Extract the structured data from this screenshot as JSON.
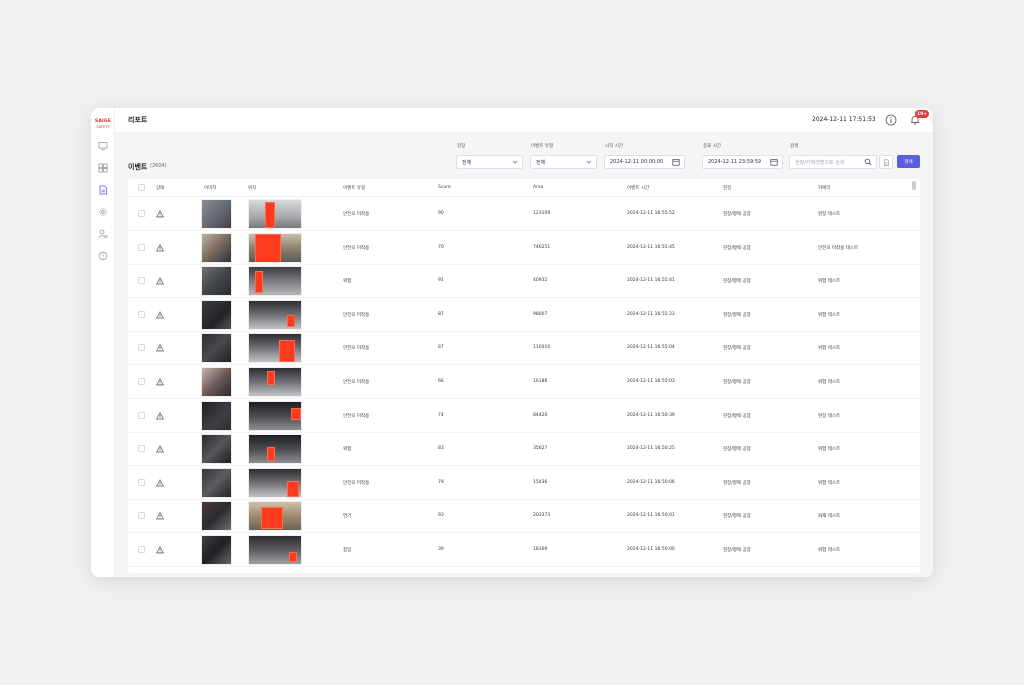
{
  "logo": {
    "line1": "SAIGE",
    "line2": "SAFETY"
  },
  "header": {
    "title": "리포트",
    "datetime": "2024-12-11 17:51:53",
    "notification_badge": "10+"
  },
  "sidebar": {
    "items": [
      {
        "icon": "monitor-icon"
      },
      {
        "icon": "dashboard-icon"
      },
      {
        "icon": "report-icon",
        "active": true
      },
      {
        "icon": "settings-icon"
      },
      {
        "icon": "user-settings-icon"
      },
      {
        "icon": "alert-icon"
      }
    ]
  },
  "section": {
    "title": "이벤트",
    "count": "(2604)"
  },
  "filters": {
    "location": {
      "label": "현장",
      "value": "전체"
    },
    "event_type": {
      "label": "이벤트 유형",
      "value": "전체"
    },
    "start_time": {
      "label": "시작 시간",
      "value": "2024-12-11 00:00:00"
    },
    "end_time": {
      "label": "종료 시간",
      "value": "2024-12-11 23:59:59"
    },
    "search": {
      "label": "검색",
      "placeholder": "현장/카메라명으로 검색"
    },
    "tilde": "~",
    "search_button": "검색"
  },
  "table": {
    "columns": [
      "상태",
      "이미지",
      "위치",
      "이벤트 유형",
      "Score",
      "Area",
      "이벤트 시간",
      "현장",
      "카메라"
    ],
    "rows": [
      {
        "type": "안전모 미착용",
        "score": "90",
        "area": "123109",
        "time": "2024-12-11 16:55:52",
        "site": "현장/평택 공장",
        "camera": "현장 테스트"
      },
      {
        "type": "안전모 미착용",
        "score": "70",
        "area": "746251",
        "time": "2024-12-11 16:55:45",
        "site": "현장/평택 공장",
        "camera": "안전모 미착용 테스트"
      },
      {
        "type": "위험",
        "score": "91",
        "area": "40932",
        "time": "2024-12-11 16:55:41",
        "site": "현장/평택 공장",
        "camera": "위험 테스트"
      },
      {
        "type": "안전모 미착용",
        "score": "87",
        "area": "98007",
        "time": "2024-12-11 16:55:23",
        "site": "현장/평택 공장",
        "camera": "위험 테스트"
      },
      {
        "type": "안전모 미착용",
        "score": "87",
        "area": "110010",
        "time": "2024-12-11 16:55:04",
        "site": "현장/평택 공장",
        "camera": "위험 테스트"
      },
      {
        "type": "안전모 미착용",
        "score": "66",
        "area": "16186",
        "time": "2024-12-11 16:55:03",
        "site": "현장/평택 공장",
        "camera": "위험 테스트"
      },
      {
        "type": "안전모 미착용",
        "score": "74",
        "area": "84420",
        "time": "2024-12-11 16:50:39",
        "site": "현장/평택 공장",
        "camera": "현장 테스트"
      },
      {
        "type": "위험",
        "score": "83",
        "area": "35627",
        "time": "2024-12-11 16:50:25",
        "site": "현장/평택 공장",
        "camera": "위험 테스트"
      },
      {
        "type": "안전모 미착용",
        "score": "79",
        "area": "15436",
        "time": "2024-12-11 16:50:06",
        "site": "현장/평택 공장",
        "camera": "위험 테스트"
      },
      {
        "type": "연기",
        "score": "93",
        "area": "203373",
        "time": "2024-12-11 16:50:01",
        "site": "현장/평택 공장",
        "camera": "화재 테스트"
      },
      {
        "type": "침입",
        "score": "39",
        "area": "18300",
        "time": "2024-12-11 16:50:00",
        "site": "현장/평택 공장",
        "camera": "위험 테스트"
      }
    ]
  },
  "colors": {
    "accent": "#5b5fde",
    "alert": "#e53935",
    "highlight": "#ff3b1f"
  }
}
